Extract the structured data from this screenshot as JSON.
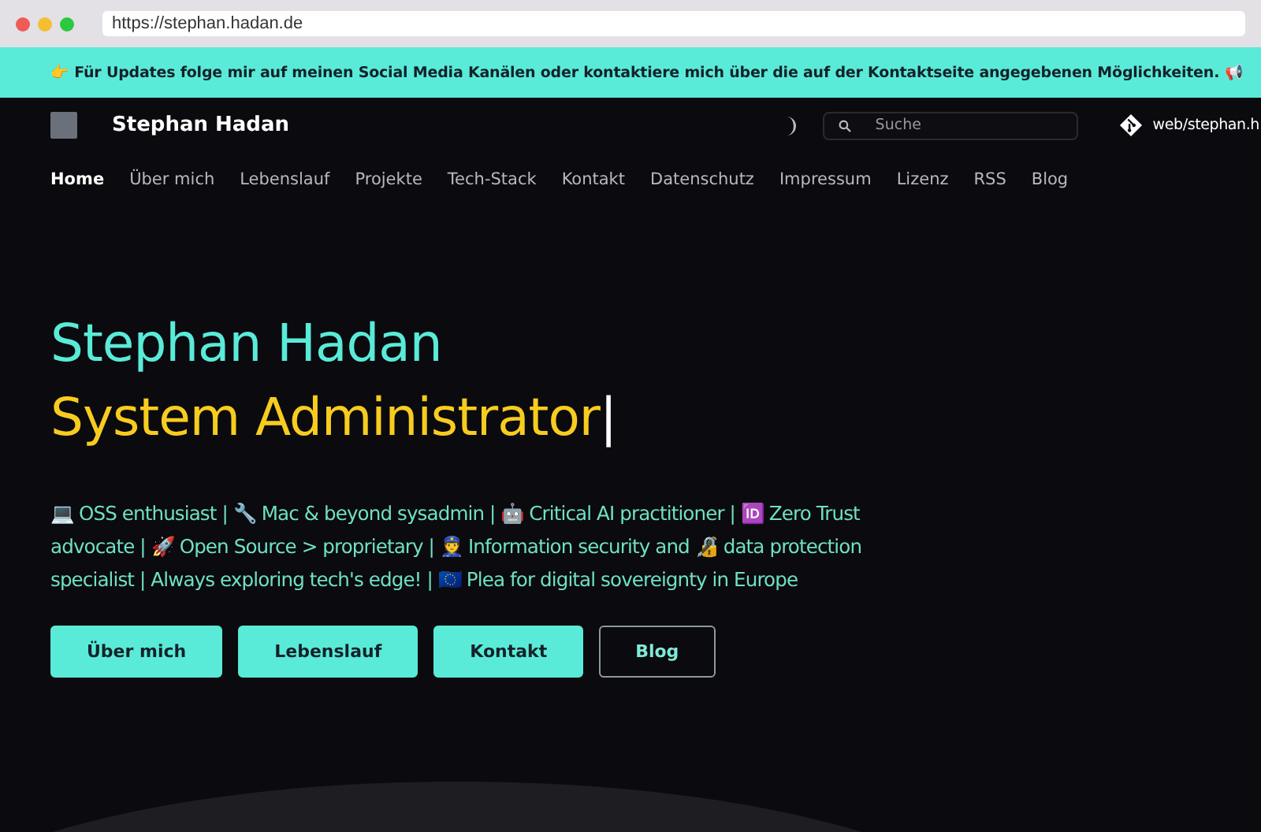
{
  "browser": {
    "url": "https://stephan.hadan.de"
  },
  "banner": {
    "text": "👉 Für Updates folge mir auf meinen Social Media Kanälen oder kontaktiere mich über die auf der Kontaktseite angegebenen Möglichkeiten. 📢"
  },
  "header": {
    "site_title": "Stephan Hadan",
    "search": {
      "placeholder": "Suche"
    },
    "repo_link": "web/stephan.h"
  },
  "nav": [
    {
      "label": "Home",
      "selected": true
    },
    {
      "label": "Über mich",
      "selected": false
    },
    {
      "label": "Lebenslauf",
      "selected": false
    },
    {
      "label": "Projekte",
      "selected": false
    },
    {
      "label": "Tech-Stack",
      "selected": false
    },
    {
      "label": "Kontakt",
      "selected": false
    },
    {
      "label": "Datenschutz",
      "selected": false
    },
    {
      "label": "Impressum",
      "selected": false
    },
    {
      "label": "Lizenz",
      "selected": false
    },
    {
      "label": "RSS",
      "selected": false
    },
    {
      "label": "Blog",
      "selected": false
    }
  ],
  "hero": {
    "name": "Stephan Hadan",
    "role": "System Administrator",
    "cursor": "|",
    "description": "💻 OSS enthusiast | 🔧 Mac & beyond sysadmin | 🤖 Critical AI practitioner | 🆔 Zero Trust advocate | 🚀 Open Source > proprietary | 👮 Information security and 🔏 data protection specialist | Always exploring tech's edge! | 🇪🇺 Plea for digital sovereignty in Europe",
    "buttons": [
      {
        "label": "Über mich",
        "kind": "filled"
      },
      {
        "label": "Lebenslauf",
        "kind": "filled"
      },
      {
        "label": "Kontakt",
        "kind": "filled"
      },
      {
        "label": "Blog",
        "kind": "outline"
      }
    ]
  }
}
